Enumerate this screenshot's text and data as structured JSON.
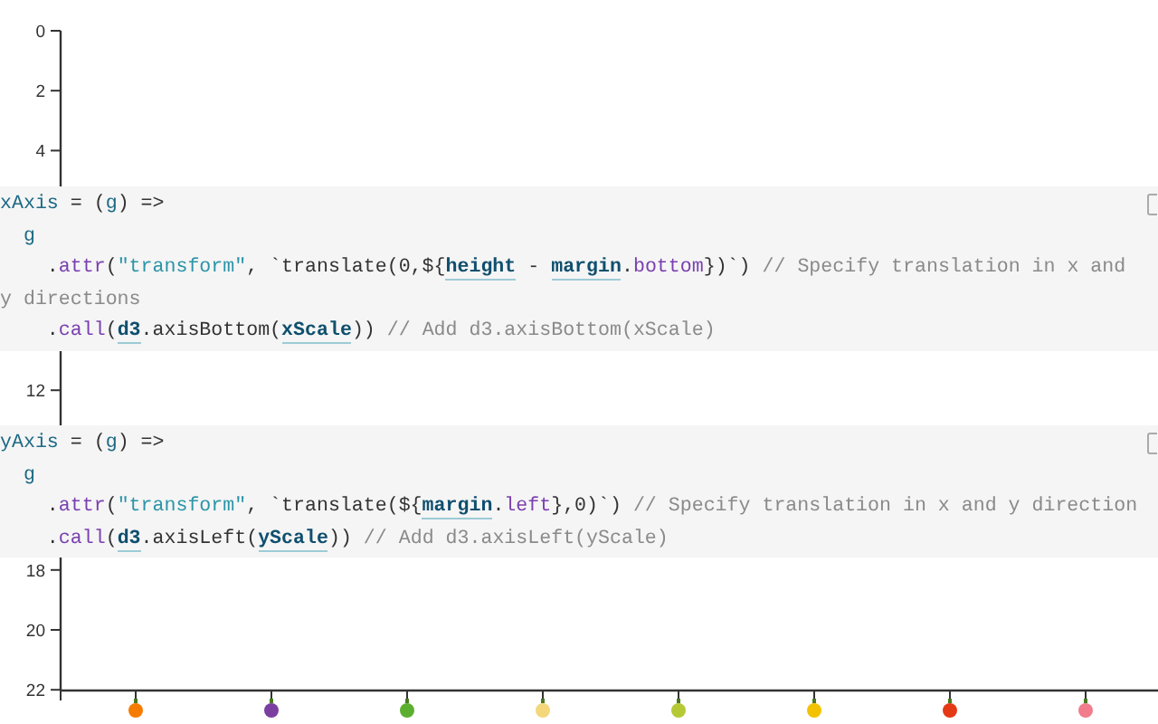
{
  "chart": {
    "y_ticks": [
      "0",
      "2",
      "4",
      "12",
      "18",
      "20",
      "22"
    ],
    "x_ticks": [
      {
        "color": "#f57c00"
      },
      {
        "color": "#7b3fa0"
      },
      {
        "color": "#5cae2e"
      },
      {
        "color": "#f3d77a"
      },
      {
        "color": "#b5c934"
      },
      {
        "color": "#f2c200"
      },
      {
        "color": "#e53915"
      },
      {
        "color": "#f07c8c"
      }
    ]
  },
  "cells": [
    {
      "lines": [
        [
          {
            "kind": "var",
            "t": "xAxis"
          },
          {
            "kind": "plain",
            "t": " = ("
          },
          {
            "kind": "var",
            "t": "g"
          },
          {
            "kind": "plain",
            "t": ") =>"
          }
        ],
        [
          {
            "kind": "var",
            "t": "  g"
          }
        ],
        [
          {
            "kind": "plain",
            "t": "    ."
          },
          {
            "kind": "method",
            "t": "attr"
          },
          {
            "kind": "plain",
            "t": "("
          },
          {
            "kind": "string",
            "t": "\"transform\""
          },
          {
            "kind": "plain",
            "t": ", `translate(0,${"
          },
          {
            "kind": "ref",
            "t": "height"
          },
          {
            "kind": "plain",
            "t": " - "
          },
          {
            "kind": "ref",
            "t": "margin"
          },
          {
            "kind": "plain",
            "t": "."
          },
          {
            "kind": "method",
            "t": "bottom"
          },
          {
            "kind": "plain",
            "t": "})`) "
          },
          {
            "kind": "comment",
            "t": "// Specify translation in x and"
          }
        ],
        [
          {
            "kind": "comment",
            "t": "y directions"
          }
        ],
        [
          {
            "kind": "plain",
            "t": "    ."
          },
          {
            "kind": "method",
            "t": "call"
          },
          {
            "kind": "plain",
            "t": "("
          },
          {
            "kind": "ref",
            "t": "d3"
          },
          {
            "kind": "plain",
            "t": ".axisBottom("
          },
          {
            "kind": "ref",
            "t": "xScale"
          },
          {
            "kind": "plain",
            "t": ")) "
          },
          {
            "kind": "comment",
            "t": "// Add d3.axisBottom(xScale)"
          }
        ]
      ]
    },
    {
      "lines": [
        [
          {
            "kind": "var",
            "t": "yAxis"
          },
          {
            "kind": "plain",
            "t": " = ("
          },
          {
            "kind": "var",
            "t": "g"
          },
          {
            "kind": "plain",
            "t": ") =>"
          }
        ],
        [
          {
            "kind": "var",
            "t": "  g"
          }
        ],
        [
          {
            "kind": "plain",
            "t": "    ."
          },
          {
            "kind": "method",
            "t": "attr"
          },
          {
            "kind": "plain",
            "t": "("
          },
          {
            "kind": "string",
            "t": "\"transform\""
          },
          {
            "kind": "plain",
            "t": ", `translate(${"
          },
          {
            "kind": "ref",
            "t": "margin"
          },
          {
            "kind": "plain",
            "t": "."
          },
          {
            "kind": "method",
            "t": "left"
          },
          {
            "kind": "plain",
            "t": "},0)`) "
          },
          {
            "kind": "comment",
            "t": "// Specify translation in x and y direction"
          }
        ],
        [
          {
            "kind": "plain",
            "t": "    ."
          },
          {
            "kind": "method",
            "t": "call"
          },
          {
            "kind": "plain",
            "t": "("
          },
          {
            "kind": "ref",
            "t": "d3"
          },
          {
            "kind": "plain",
            "t": ".axisLeft("
          },
          {
            "kind": "ref",
            "t": "yScale"
          },
          {
            "kind": "plain",
            "t": ")) "
          },
          {
            "kind": "comment",
            "t": "// Add d3.axisLeft(yScale)"
          }
        ]
      ]
    }
  ]
}
